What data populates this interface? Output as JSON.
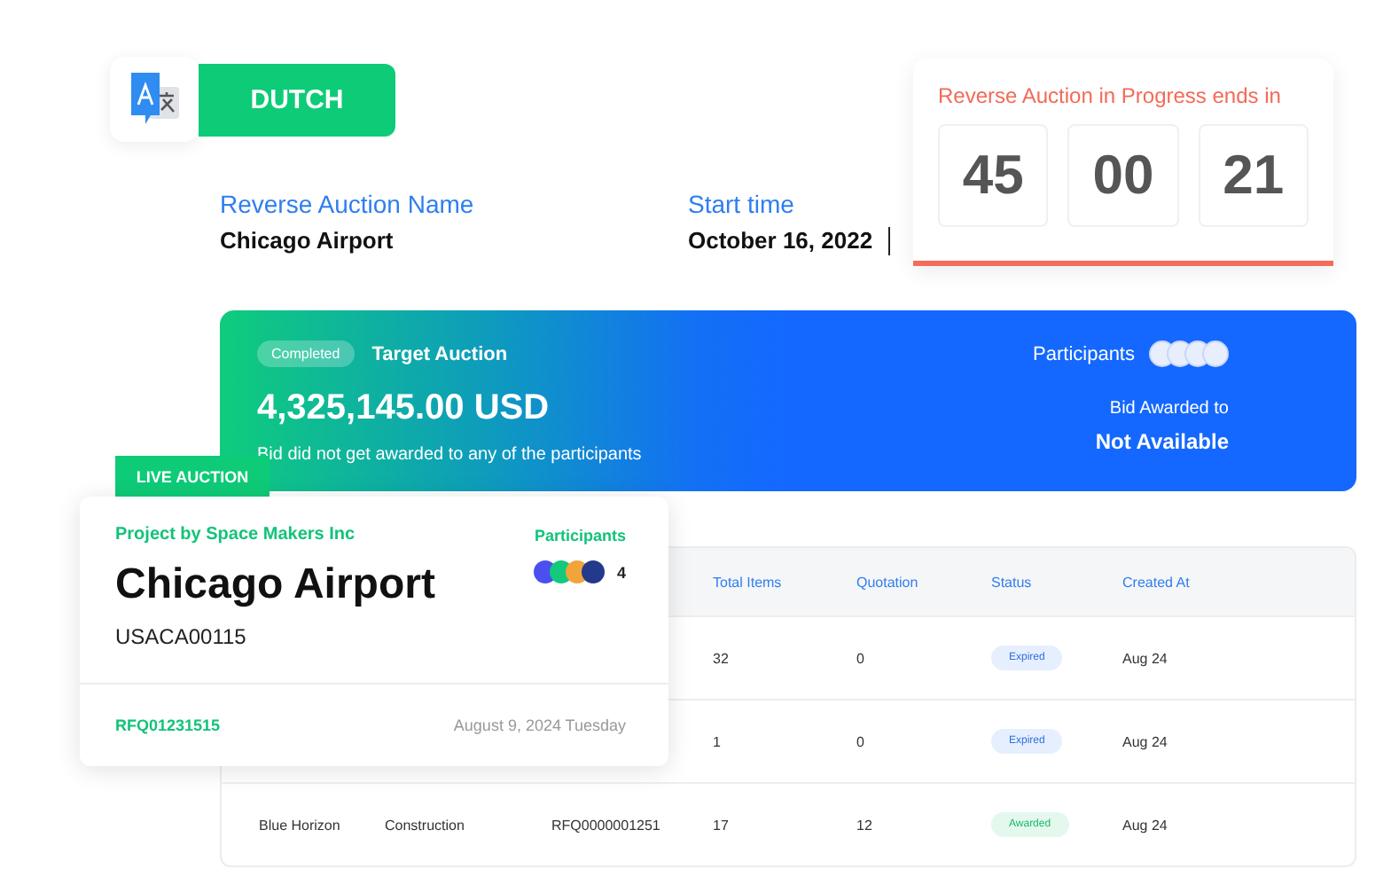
{
  "language": {
    "label": "DUTCH"
  },
  "fields": [
    {
      "label": "Reverse Auction Name",
      "value": "Chicago Airport",
      "cursor": false
    },
    {
      "label": "Start time",
      "value": "October 16, 2022",
      "cursor": true
    }
  ],
  "timer": {
    "title": "Reverse Auction in Progress ends in",
    "digits": [
      "45",
      "00",
      "21"
    ]
  },
  "banner": {
    "status": "Completed",
    "title": "Target Auction",
    "amount": "4,325,145.00 USD",
    "note": "Bid did not get awarded to any of the participants",
    "participants_label": "Participants",
    "awarded_label": "Bid Awarded to",
    "awarded_value": "Not Available"
  },
  "live_card": {
    "tag": "LIVE AUCTION",
    "project": "Project by Space Makers Inc",
    "participants_label": "Participants",
    "participants": [
      {
        "color": "#4b4ff0"
      },
      {
        "color": "#12c97c"
      },
      {
        "color": "#f2a43a"
      },
      {
        "color": "#23398c"
      }
    ],
    "participant_count": "4",
    "title": "Chicago Airport",
    "code": "USACA00115",
    "rfq": "RFQ01231515",
    "date": "August 9, 2024 Tuesday"
  },
  "table": {
    "columns": [
      "Total Items",
      "Quotation",
      "Status",
      "Created At"
    ],
    "rows": [
      {
        "total_items": "32",
        "quotation": "0",
        "status": {
          "label": "Expired",
          "kind": "expired"
        },
        "created_at": "Aug 24"
      },
      {
        "total_items": "1",
        "quotation": "0",
        "status": {
          "label": "Expired",
          "kind": "expired"
        },
        "created_at": "Aug 24"
      },
      {
        "name": "Blue Horizon",
        "category": "Construction",
        "rfq": "RFQ0000001251",
        "total_items": "17",
        "quotation": "12",
        "status": {
          "label": "Awarded",
          "kind": "awarded"
        },
        "created_at": "Aug 24"
      }
    ]
  }
}
